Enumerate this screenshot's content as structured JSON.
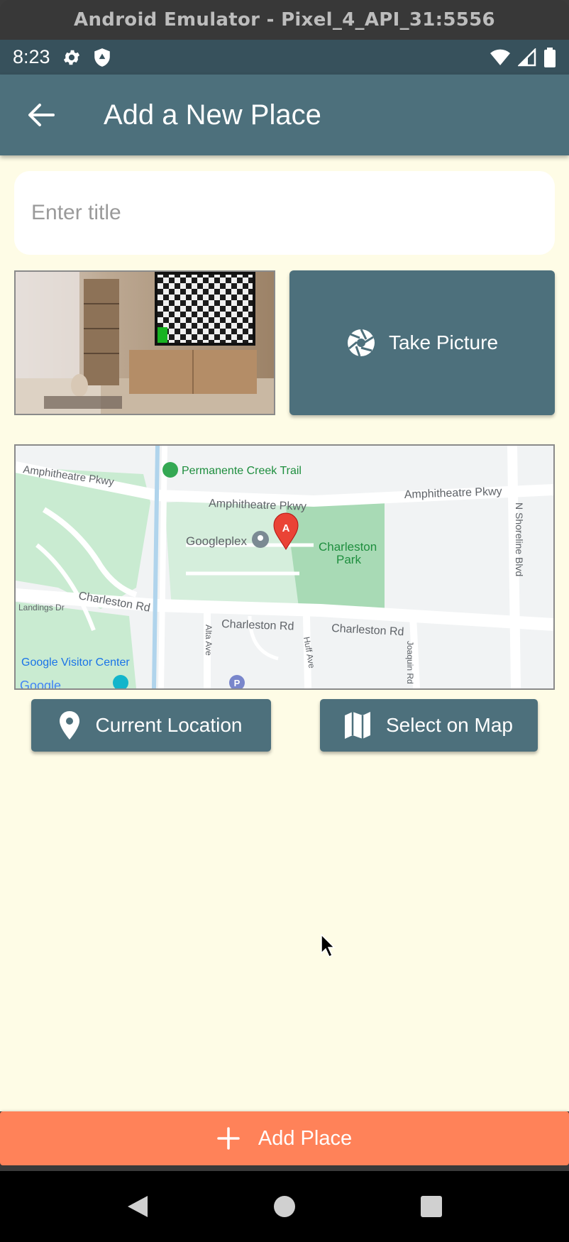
{
  "window": {
    "title": "Android Emulator - Pixel_4_API_31:5556"
  },
  "status_bar": {
    "time": "8:23"
  },
  "app_bar": {
    "title": "Add a New Place"
  },
  "form": {
    "title_placeholder": "Enter title",
    "title_value": ""
  },
  "image_section": {
    "take_picture_label": "Take Picture"
  },
  "map": {
    "labels": {
      "amphitheatre_pkwy_1": "Amphitheatre Pkwy",
      "amphitheatre_pkwy_2": "Amphitheatre Pkwy",
      "amphitheatre_pkwy_3": "Amphitheatre Pkwy",
      "permanente_trail": "Permanente Creek Trail",
      "googleplex": "Googleplex",
      "charleston_park_1": "Charleston",
      "charleston_park_2": "Park",
      "shoreline": "N Shoreline Blvd",
      "landings": "Landings Dr",
      "charleston_rd_1": "Charleston Rd",
      "charleston_rd_2": "Charleston Rd",
      "charleston_rd_3": "Charleston Rd",
      "alta": "Alta Ave",
      "huff": "Huff Ave",
      "joaquin": "Joaquin Rd",
      "visitor_center": "Google Visitor Center",
      "marker_letter": "A",
      "parking": "P",
      "google_logo": "Google"
    }
  },
  "location_buttons": {
    "current_label": "Current Location",
    "select_label": "Select on Map"
  },
  "submit": {
    "add_place_label": "Add Place"
  },
  "colors": {
    "app_bar": "#4d707c",
    "status_bar": "#37515c",
    "background": "#fefce6",
    "accent": "#ff8259",
    "map_park": "#a8dab5",
    "marker": "#ea4335"
  }
}
